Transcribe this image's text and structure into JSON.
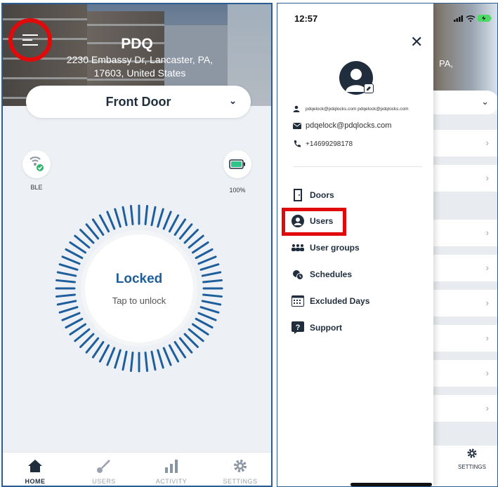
{
  "left": {
    "lock": {
      "name": "PDQ",
      "address": "2230 Embassy Dr, Lancaster, PA, 17603, United States"
    },
    "door_select": {
      "label": "Front Door"
    },
    "ble": {
      "label": "BLE"
    },
    "battery": {
      "label": "100%"
    },
    "lock_state": {
      "status": "Locked",
      "hint": "Tap to unlock"
    },
    "nav": {
      "home": "HOME",
      "users": "USERS",
      "activity": "ACTIVITY",
      "settings": "SETTINGS"
    }
  },
  "right": {
    "status_bar": {
      "time": "12:57"
    },
    "hero_fragment": "PA,",
    "profile": {
      "username": "pdqelock@pdqlocks.com pdqelock@pdqlocks.com",
      "email": "pdqelock@pdqlocks.com",
      "phone": "+14699298178"
    },
    "menu": {
      "doors": "Doors",
      "users": "Users",
      "user_groups": "User groups",
      "schedules": "Schedules",
      "excluded_days": "Excluded Days",
      "support": "Support"
    },
    "settings_label": "SETTINGS"
  },
  "colors": {
    "accent_blue": "#1f5e9c",
    "highlight_red": "#e10a0a",
    "dark_navy": "#1f2d3d",
    "battery_green": "#2fc48a"
  },
  "icons": {
    "menu": "hamburger-menu-icon",
    "ble": "ble-signal-icon",
    "battery": "battery-icon",
    "home": "home-icon",
    "users": "key-icon",
    "activity": "bar-chart-icon",
    "settings": "gear-icon",
    "close": "close-icon",
    "avatar": "user-avatar-icon",
    "doors": "door-icon",
    "user_menu": "user-circle-icon",
    "user_groups": "user-groups-icon",
    "schedules": "schedule-clock-icon",
    "excluded_days": "calendar-icon",
    "support": "help-icon"
  }
}
